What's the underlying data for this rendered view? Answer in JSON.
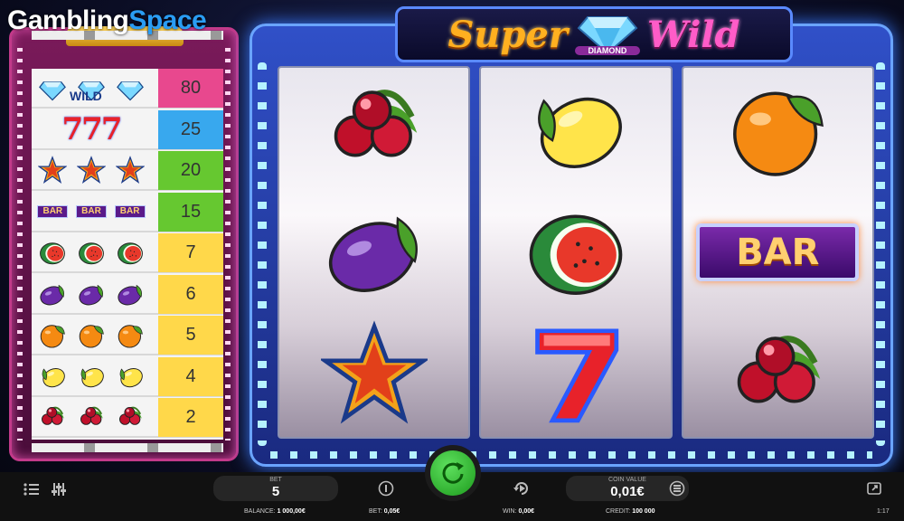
{
  "watermark": {
    "part1": "Gambling",
    "part2": "Space"
  },
  "logo": {
    "word1": "Super",
    "badge": "DIAMOND",
    "word2": "Wild"
  },
  "paytable": [
    {
      "symbol": "wild-diamond",
      "label": "WILD",
      "payout": "80",
      "color": "#e8488e"
    },
    {
      "symbol": "seven",
      "label": "777",
      "payout": "25",
      "color": "#38a8ee"
    },
    {
      "symbol": "star",
      "label": "",
      "payout": "20",
      "color": "#66c830"
    },
    {
      "symbol": "bar",
      "label": "BAR",
      "payout": "15",
      "color": "#66c830"
    },
    {
      "symbol": "watermelon",
      "label": "",
      "payout": "7",
      "color": "#ffd84a"
    },
    {
      "symbol": "plum",
      "label": "",
      "payout": "6",
      "color": "#ffd84a"
    },
    {
      "symbol": "orange",
      "label": "",
      "payout": "5",
      "color": "#ffd84a"
    },
    {
      "symbol": "lemon",
      "label": "",
      "payout": "4",
      "color": "#ffd84a"
    },
    {
      "symbol": "cherry",
      "label": "",
      "payout": "2",
      "color": "#ffd84a"
    }
  ],
  "reels": [
    [
      "cherry",
      "plum",
      "star"
    ],
    [
      "lemon",
      "watermelon",
      "seven"
    ],
    [
      "orange",
      "bar",
      "cherry"
    ]
  ],
  "reel_bar_label": "BAR",
  "controls": {
    "bet_label": "BET",
    "bet_value": "5",
    "coin_label": "COIN VALUE",
    "coin_value": "0,01€",
    "balance_label": "BALANCE:",
    "balance_value": "1 000,00€",
    "bet2_label": "BET:",
    "bet2_value": "0,05€",
    "win_label": "WIN:",
    "win_value": "0,00€",
    "credit_label": "CREDIT:",
    "credit_value": "100 000",
    "clock": "1:17"
  }
}
